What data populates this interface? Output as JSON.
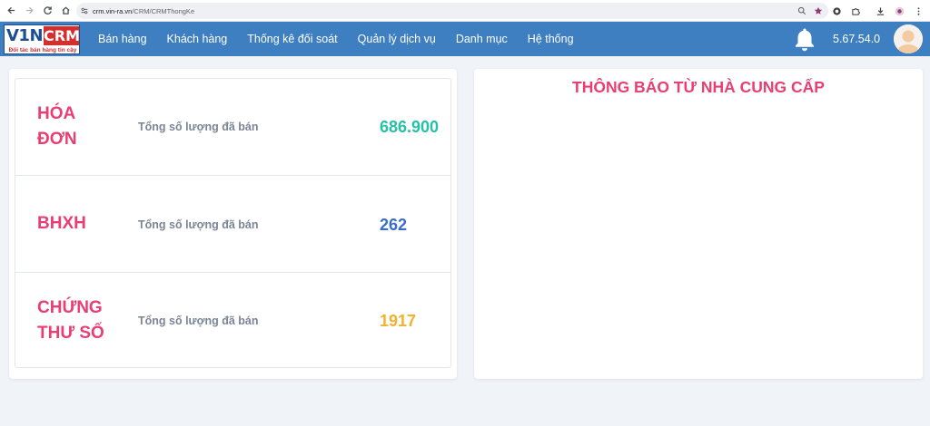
{
  "browser": {
    "url_host": "crm.vin-ra.vn",
    "url_path": "/CRM/CRMThongKe"
  },
  "app": {
    "logo_left": "V1N",
    "logo_right": "CRM",
    "logo_tagline": "Đối tác bán hàng tin cậy",
    "menu": [
      {
        "label": "Bán hàng"
      },
      {
        "label": "Khách hàng"
      },
      {
        "label": "Thống kê đối soát"
      },
      {
        "label": "Quản lý dịch vụ"
      },
      {
        "label": "Danh mục"
      },
      {
        "label": "Hệ thống"
      }
    ],
    "version": "5.67.54.0"
  },
  "stats": [
    {
      "title_line1": "HÓA",
      "title_line2": "ĐƠN",
      "label": "Tổng số lượng đã bán",
      "value": "686.900",
      "color": "#26c0a6"
    },
    {
      "title_line1": "BHXH",
      "title_line2": "",
      "label": "Tổng số lượng đã bán",
      "value": "262",
      "color": "#3a6cc9"
    },
    {
      "title_line1": "CHỨNG",
      "title_line2": "THƯ SỐ",
      "label": "Tổng số lượng đã bán",
      "value": "1917",
      "color": "#f3b12d"
    }
  ],
  "notice_panel": {
    "title": "THÔNG BÁO TỪ NHÀ CUNG CẤP"
  },
  "colors": {
    "navbar": "#3e7fc1",
    "accent": "#e83e73"
  }
}
